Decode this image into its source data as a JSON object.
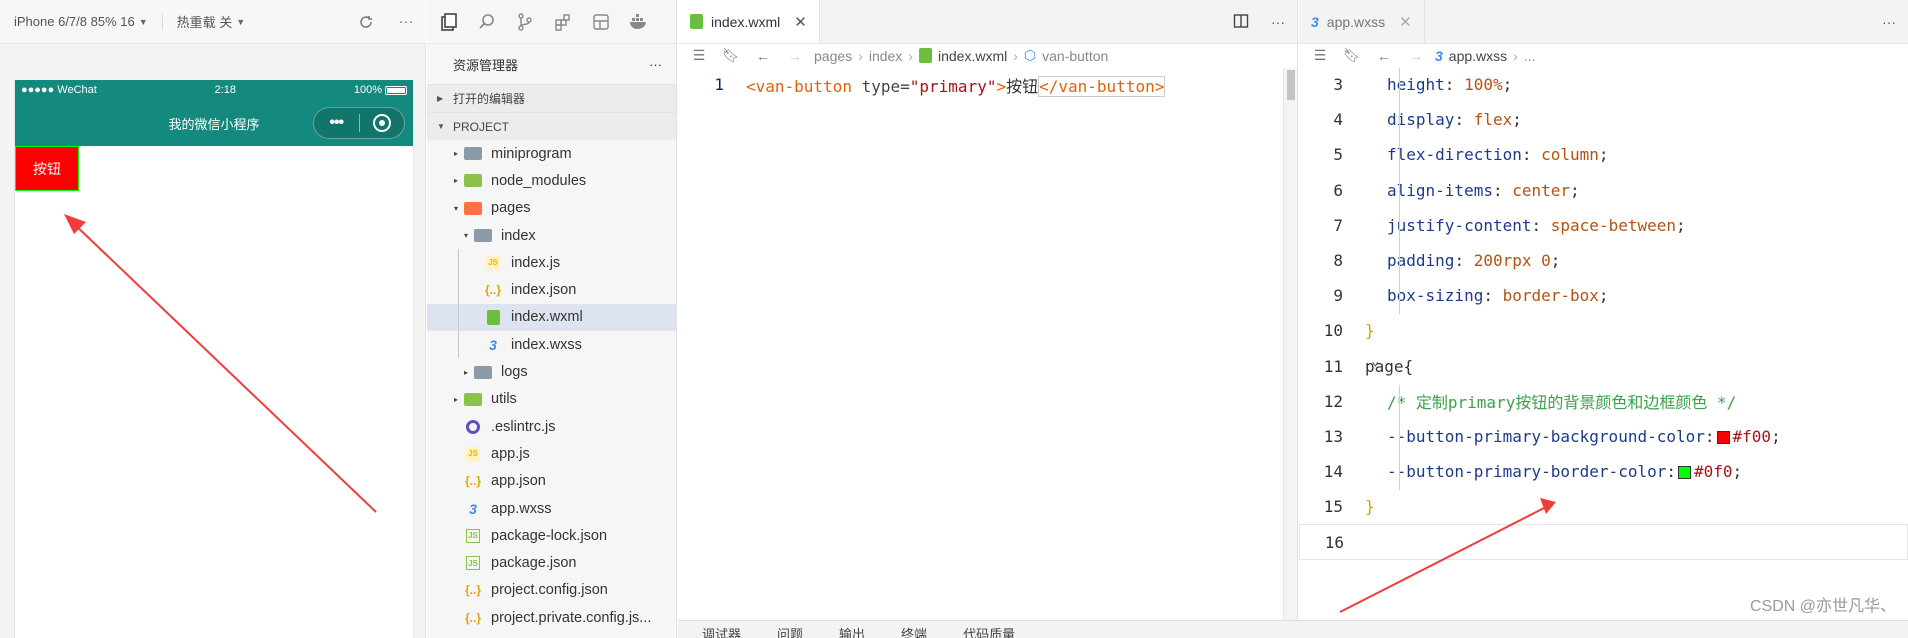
{
  "simulator": {
    "device_label": "iPhone 6/7/8 85% 16",
    "hot_reload_label": "热重载 关",
    "status_carrier": "●●●●● WeChat",
    "status_time": "2:18",
    "status_battery": "100%",
    "nav_title": "我的微信小程序",
    "button_text": "按钮"
  },
  "explorer": {
    "title": "资源管理器",
    "more": "···",
    "open_editors": "打开的编辑器",
    "project": "PROJECT",
    "items": [
      {
        "label": "miniprogram",
        "icon": "folder-icon",
        "twisty": "▸"
      },
      {
        "label": "node_modules",
        "icon": "node-modules-folder-icon",
        "twisty": "▸"
      },
      {
        "label": "pages",
        "icon": "pages-folder-icon",
        "twisty": "▾"
      },
      {
        "label": "index",
        "icon": "folder-icon",
        "twisty": "▾"
      },
      {
        "label": "index.js",
        "icon": "js-file-icon",
        "twisty": ""
      },
      {
        "label": "index.json",
        "icon": "json-file-icon",
        "twisty": ""
      },
      {
        "label": "index.wxml",
        "icon": "wxml-file-icon",
        "twisty": ""
      },
      {
        "label": "index.wxss",
        "icon": "wxss-file-icon",
        "twisty": ""
      },
      {
        "label": "logs",
        "icon": "folder-icon",
        "twisty": "▸"
      },
      {
        "label": "utils",
        "icon": "utils-folder-icon",
        "twisty": "▸"
      },
      {
        "label": ".eslintrc.js",
        "icon": "eslint-file-icon",
        "twisty": ""
      },
      {
        "label": "app.js",
        "icon": "js-file-icon",
        "twisty": ""
      },
      {
        "label": "app.json",
        "icon": "json-file-icon",
        "twisty": ""
      },
      {
        "label": "app.wxss",
        "icon": "wxss-file-icon",
        "twisty": ""
      },
      {
        "label": "package-lock.json",
        "icon": "node-file-icon",
        "twisty": ""
      },
      {
        "label": "package.json",
        "icon": "node-file-icon",
        "twisty": ""
      },
      {
        "label": "project.config.json",
        "icon": "json-file-icon",
        "twisty": ""
      },
      {
        "label": "project.private.config.js...",
        "icon": "json-file-icon",
        "twisty": ""
      }
    ],
    "selected": "index.wxml"
  },
  "editor1": {
    "tab_label": "index.wxml",
    "breadcrumb": [
      "pages",
      "index",
      "index.wxml",
      "van-button"
    ],
    "line_number": "1",
    "code": {
      "open_tag": "<van-button",
      "attr_name": " type=",
      "attr_value": "\"primary\"",
      "gt": ">",
      "text": "按钮",
      "close_tag": "</van-button>"
    }
  },
  "editor2": {
    "tab_label": "app.wxss",
    "breadcrumb": [
      "app.wxss",
      "..."
    ],
    "lines": [
      {
        "n": "3",
        "prop": "height",
        "val": "100%"
      },
      {
        "n": "4",
        "prop": "display",
        "val": "flex"
      },
      {
        "n": "5",
        "prop": "flex-direction",
        "val": "column"
      },
      {
        "n": "6",
        "prop": "align-items",
        "val": "center"
      },
      {
        "n": "7",
        "prop": "justify-content",
        "val": "space-between"
      },
      {
        "n": "8",
        "prop": "padding",
        "val": "200rpx 0"
      },
      {
        "n": "9",
        "prop": "box-sizing",
        "val": "border-box"
      },
      {
        "n": "10",
        "text": "}"
      },
      {
        "n": "11",
        "text": "page{"
      },
      {
        "n": "12",
        "text": "/* 定制primary按钮的背景颜色和边框颜色 */"
      },
      {
        "n": "13",
        "prop": "--button-primary-background-color",
        "val": "#f00",
        "swatch": "#ff0000"
      },
      {
        "n": "14",
        "prop": "--button-primary-border-color",
        "val": "#0f0",
        "swatch": "#00ff00"
      },
      {
        "n": "15",
        "text": "}"
      },
      {
        "n": "16",
        "text": ""
      }
    ]
  },
  "bottom_tabs": [
    "调试器",
    "问题",
    "输出",
    "终端",
    "代码质量"
  ],
  "watermark": "CSDN @亦世凡华、",
  "colors": {
    "nav": "#148a7e",
    "button_bg": "#ff0000",
    "button_border": "#00ff00",
    "arrow": "#f23b3b"
  }
}
